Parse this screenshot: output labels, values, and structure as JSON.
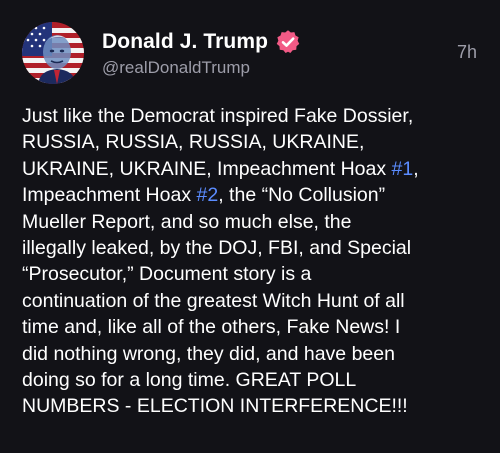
{
  "post": {
    "author": {
      "display_name": "Donald J. Trump",
      "handle": "@realDonaldTrump",
      "verified_icon": "verified-badge-icon",
      "avatar_icon": "flag-portrait-avatar"
    },
    "timestamp": "7h",
    "body_lines": [
      [
        {
          "text": "Just like the Democrat inspired Fake Dossier,"
        }
      ],
      [
        {
          "text": "RUSSIA, RUSSIA, RUSSIA, UKRAINE,"
        }
      ],
      [
        {
          "text": "UKRAINE, UKRAINE, Impeachment Hoax "
        },
        {
          "text": "#1",
          "hashtag": true
        },
        {
          "text": ","
        }
      ],
      [
        {
          "text": "Impeachment Hoax "
        },
        {
          "text": "#2",
          "hashtag": true
        },
        {
          "text": ", the “No Collusion”"
        }
      ],
      [
        {
          "text": "Mueller Report, and so much else, the"
        }
      ],
      [
        {
          "text": "illegally leaked, by the DOJ, FBI, and Special"
        }
      ],
      [
        {
          "text": "“Prosecutor,” Document story is a"
        }
      ],
      [
        {
          "text": "continuation of the greatest Witch Hunt of all"
        }
      ],
      [
        {
          "text": "time and, like all of the others, Fake News! I"
        }
      ],
      [
        {
          "text": "did nothing wrong, they did, and have been"
        }
      ],
      [
        {
          "text": "doing so for a long time. GREAT POLL"
        }
      ],
      [
        {
          "text": "NUMBERS - ELECTION INTERFERENCE!!!"
        }
      ]
    ],
    "colors": {
      "background": "#121217",
      "text": "#ffffff",
      "secondary": "#9d9da9",
      "hashtag": "#5b8cff",
      "verified": "#f25a86"
    }
  }
}
